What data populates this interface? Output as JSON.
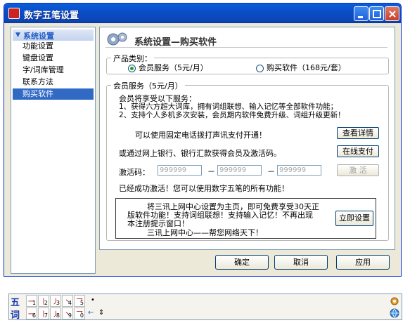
{
  "window": {
    "title": "数字五笔设置"
  },
  "sidebar": {
    "section": "系统设置",
    "items": [
      "功能设置",
      "键盘设置",
      "字/词库管理",
      "联系方法",
      "购买软件"
    ],
    "selected_index": 4
  },
  "header": {
    "title": "系统设置—购买软件"
  },
  "product": {
    "legend": "产品类别：",
    "options": [
      {
        "label": "会员服务（5元/月）",
        "selected": true
      },
      {
        "label": "购买软件（168元/套）",
        "selected": false
      }
    ]
  },
  "member": {
    "legend": "会员服务（5元/月）",
    "intro": "会员将享受以下服务：",
    "benefit1": "1、获得六方超大词库，拥有词组联想、输入记忆等全部软件功能；",
    "benefit2": "2、支持个人多机多次安装，会员期内软件免费升级、词组升级更新！",
    "phone_text": "可以使用固定电话拨打声讯支付开通！",
    "details_button": "查看详情",
    "online_text": "或通过网上银行、银行汇款获得会员及激活码。",
    "online_button": "在线支付",
    "code_label": "激活码：",
    "code_placeholder": "999999",
    "code_separator": "－",
    "activate_button": "激  活",
    "status": "已经成功激活！您可以使用数字五笔的所有功能！",
    "promo_lines": [
      "将三讯上网中心设置为主页，即可免费享受30天正",
      "版软件功能！支持词组联想！支持输入记忆！不再出现",
      "本注册提示窗口！",
      "三讯上网中心——帮您网络天下！"
    ],
    "setup_button": "立即设置"
  },
  "footer": {
    "ok": "确定",
    "cancel": "取消",
    "apply": "应用"
  },
  "ime": {
    "logo_top": "五",
    "logo_bottom": "词",
    "row1": [
      {
        "s": "一",
        "n": "1"
      },
      {
        "s": "丨",
        "n": "2"
      },
      {
        "s": "丿",
        "n": "3"
      },
      {
        "s": "丶",
        "n": "4"
      },
      {
        "s": "乛",
        "n": "5"
      }
    ],
    "row2": [
      {
        "s": "一",
        "n": "6"
      },
      {
        "s": "丨",
        "n": "7"
      },
      {
        "s": "丿",
        "n": "8"
      },
      {
        "s": "丶",
        "n": "9"
      },
      {
        "s": "乛",
        "n": "0"
      }
    ],
    "sym1": "•",
    "sym2_left": "←",
    "sym2_updown": "⇕"
  }
}
